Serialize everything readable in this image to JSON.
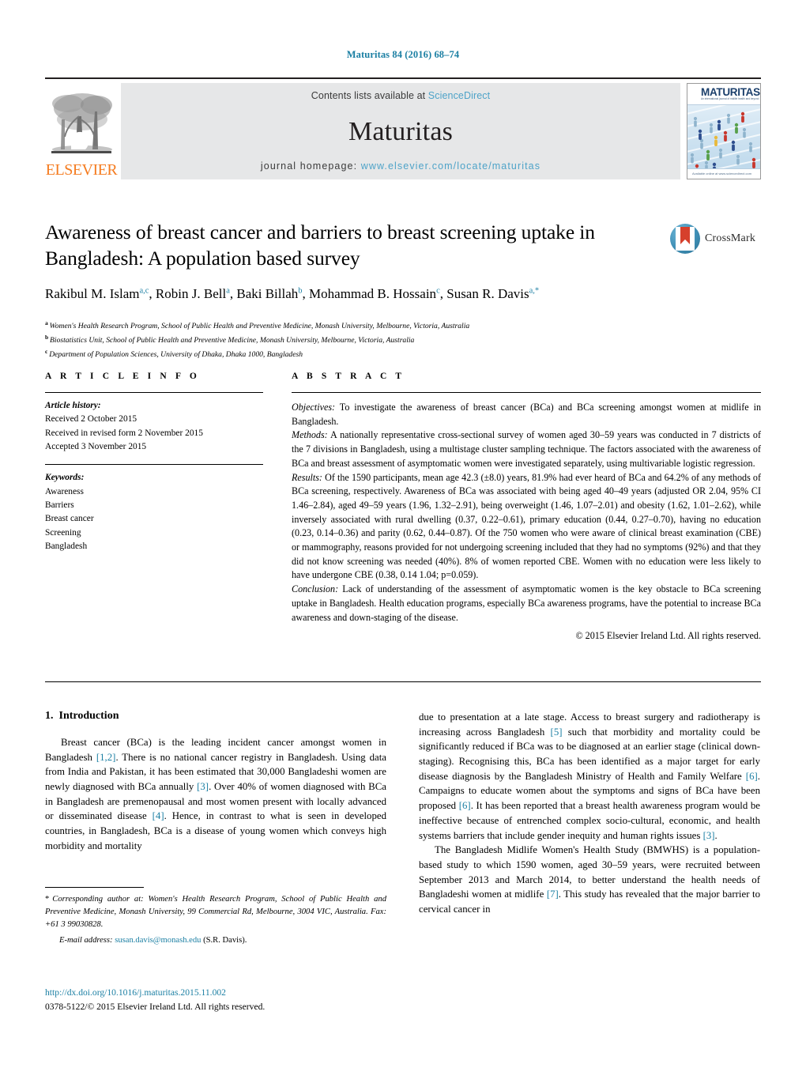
{
  "running_head": "Maturitas 84 (2016) 68–74",
  "masthead": {
    "publisher_name": "ELSEVIER",
    "contents_prefix": "Contents lists available at ",
    "contents_link": "ScienceDirect",
    "journal_name": "Maturitas",
    "homepage_prefix": "journal homepage: ",
    "homepage_url": "www.elsevier.com/locate/maturitas",
    "cover": {
      "title": "MATURITAS",
      "subtitle": "An international journal of midlife health and beyond",
      "footer": "Available online at www.sciencedirect.com"
    }
  },
  "article": {
    "title": "Awareness of breast cancer and barriers to breast screening uptake in Bangladesh: A population based survey",
    "authors": [
      {
        "name": "Rakibul M. Islam",
        "sup": "a,c",
        "sep": ", "
      },
      {
        "name": "Robin J. Bell",
        "sup": "a",
        "sep": ", "
      },
      {
        "name": "Baki Billah",
        "sup": "b",
        "sep": ", "
      },
      {
        "name": "Mohammad B. Hossain",
        "sup": "c",
        "sep": ", "
      },
      {
        "name": "Susan R. Davis",
        "sup": "a,*",
        "sep": ""
      }
    ],
    "affiliations": [
      {
        "mark": "a",
        "text": "Women's Health Research Program, School of Public Health and Preventive Medicine, Monash University, Melbourne, Victoria, Australia"
      },
      {
        "mark": "b",
        "text": "Biostatistics Unit, School of Public Health and Preventive Medicine, Monash University, Melbourne, Victoria, Australia"
      },
      {
        "mark": "c",
        "text": "Department of Population Sciences, University of Dhaka, Dhaka 1000, Bangladesh"
      }
    ],
    "crossmark_label": "CrossMark"
  },
  "article_info": {
    "heading": "A R T I C L E   I N F O",
    "history_label": "Article history:",
    "history": [
      "Received 2 October 2015",
      "Received in revised form 2 November 2015",
      "Accepted 3 November 2015"
    ],
    "keywords_label": "Keywords:",
    "keywords": [
      "Awareness",
      "Barriers",
      "Breast cancer",
      "Screening",
      "Bangladesh"
    ]
  },
  "abstract": {
    "heading": "A B S T R A C T",
    "sections": [
      {
        "label": "Objectives:",
        "text": " To investigate the awareness of breast cancer (BCa) and BCa screening amongst women at midlife in Bangladesh."
      },
      {
        "label": "Methods:",
        "text": " A nationally representative cross-sectional survey of women aged 30–59 years was conducted in 7 districts of the 7 divisions in Bangladesh, using a multistage cluster sampling technique. The factors associated with the awareness of BCa and breast assessment of asymptomatic women were investigated separately, using multivariable logistic regression."
      },
      {
        "label": "Results:",
        "text": " Of the 1590 participants, mean age 42.3 (±8.0) years, 81.9% had ever heard of BCa and 64.2% of any methods of BCa screening, respectively. Awareness of BCa was associated with being aged 40–49 years (adjusted OR 2.04, 95% CI 1.46–2.84), aged 49–59 years (1.96, 1.32–2.91), being overweight (1.46, 1.07–2.01) and obesity (1.62, 1.01–2.62), while inversely associated with rural dwelling (0.37, 0.22–0.61), primary education (0.44, 0.27–0.70), having no education (0.23, 0.14–0.36) and parity (0.62, 0.44–0.87). Of the 750 women who were aware of clinical breast examination (CBE) or mammography, reasons provided for not undergoing screening included that they had no symptoms (92%) and that they did not know screening was needed (40%). 8% of women reported CBE. Women with no education were less likely to have undergone CBE (0.38, 0.14 1.04; p=0.059)."
      },
      {
        "label": "Conclusion:",
        "text": " Lack of understanding of the assessment of asymptomatic women is the key obstacle to BCa screening uptake in Bangladesh. Health education programs, especially BCa awareness programs, have the potential to increase BCa awareness and down-staging of the disease."
      }
    ],
    "copyright": "© 2015 Elsevier Ireland Ltd. All rights reserved."
  },
  "introduction": {
    "number": "1.",
    "title": "Introduction",
    "left_paragraphs": [
      {
        "indent": true,
        "parts": [
          {
            "t": "Breast cancer (BCa) is the leading incident cancer amongst women in Bangladesh "
          },
          {
            "t": "[1,2]",
            "ref": true
          },
          {
            "t": ". There is no national cancer registry in Bangladesh. Using data from India and Pakistan, it has been estimated that 30,000 Bangladeshi women are newly diagnosed with BCa annually "
          },
          {
            "t": "[3]",
            "ref": true
          },
          {
            "t": ". Over 40% of women diagnosed with BCa in Bangladesh are premenopausal and most women present with locally advanced or disseminated disease "
          },
          {
            "t": "[4]",
            "ref": true
          },
          {
            "t": ". Hence, in contrast to what is seen in developed countries, in Bangladesh, BCa is a disease of young women which conveys high morbidity and mortality"
          }
        ]
      }
    ],
    "right_paragraphs": [
      {
        "indent": false,
        "parts": [
          {
            "t": "due to presentation at a late stage. Access to breast surgery and radiotherapy is increasing across Bangladesh "
          },
          {
            "t": "[5]",
            "ref": true
          },
          {
            "t": " such that morbidity and mortality could be significantly reduced if BCa was to be diagnosed at an earlier stage (clinical down-staging). Recognising this, BCa has been identified as a major target for early disease diagnosis by the Bangladesh Ministry of Health and Family Welfare "
          },
          {
            "t": "[6]",
            "ref": true
          },
          {
            "t": ". Campaigns to educate women about the symptoms and signs of BCa have been proposed "
          },
          {
            "t": "[6]",
            "ref": true
          },
          {
            "t": ". It has been reported that a breast health awareness program would be ineffective because of entrenched complex socio-cultural, economic, and health systems barriers that include gender inequity and human rights issues "
          },
          {
            "t": "[3]",
            "ref": true
          },
          {
            "t": "."
          }
        ]
      },
      {
        "indent": true,
        "parts": [
          {
            "t": "The Bangladesh Midlife Women's Health Study (BMWHS) is a population-based study to which 1590 women, aged 30–59 years, were recruited between September 2013 and March 2014, to better understand the health needs of Bangladeshi women at midlife "
          },
          {
            "t": "[7]",
            "ref": true
          },
          {
            "t": ". This study has revealed that the major barrier to cervical cancer in"
          }
        ]
      }
    ]
  },
  "footnote": {
    "star": "*",
    "text": "Corresponding author at: Women's Health Research Program, School of Public Health and Preventive Medicine, Monash University, 99 Commercial Rd, Melbourne, 3004 VIC, Australia. Fax: +61 3 99030828.",
    "email_label": "E-mail address:",
    "email": "susan.davis@monash.edu",
    "email_suffix": " (S.R. Davis)."
  },
  "footer": {
    "doi": "http://dx.doi.org/10.1016/j.maturitas.2015.11.002",
    "issn": "0378-5122/© 2015 Elsevier Ireland Ltd. All rights reserved."
  },
  "colors": {
    "link_blue": "#1b7fa3",
    "elsevier_orange": "#f57c20",
    "band_grey": "#e6e7e8",
    "sciencedirect_blue": "#4ea3c8"
  }
}
